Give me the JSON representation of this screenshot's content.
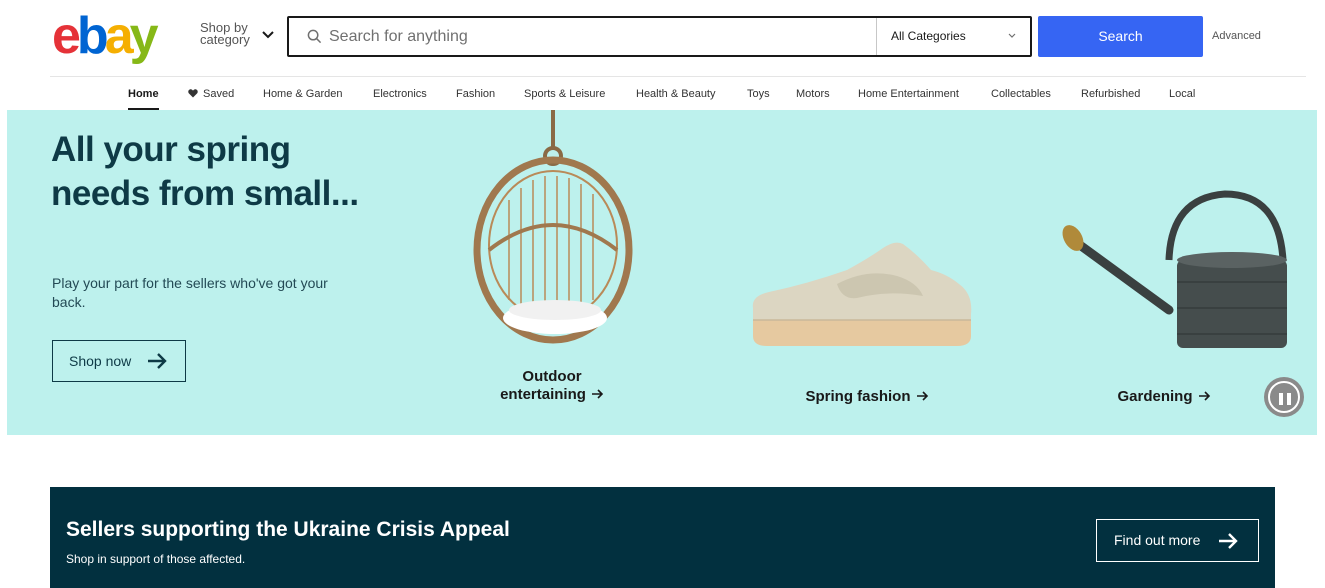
{
  "header": {
    "logo_letters": [
      "e",
      "b",
      "a",
      "y"
    ],
    "shop_by_label": "Shop by category",
    "search_placeholder": "Search for anything",
    "category_selected": "All Categories",
    "search_button": "Search",
    "advanced_link": "Advanced"
  },
  "nav": {
    "items": [
      {
        "label": "Home",
        "active": true
      },
      {
        "label": "Saved"
      },
      {
        "label": "Home & Garden"
      },
      {
        "label": "Electronics"
      },
      {
        "label": "Fashion"
      },
      {
        "label": "Sports & Leisure"
      },
      {
        "label": "Health & Beauty"
      },
      {
        "label": "Toys"
      },
      {
        "label": "Motors"
      },
      {
        "label": "Home Entertainment"
      },
      {
        "label": "Collectables"
      },
      {
        "label": "Refurbished"
      },
      {
        "label": "Local"
      }
    ]
  },
  "hero": {
    "title": "All your spring needs from small...",
    "subtitle": "Play your part for the sellers who've got your back.",
    "cta": "Shop now",
    "products": [
      {
        "label_line1": "Outdoor",
        "label_line2": "entertaining",
        "icon": "hanging-chair"
      },
      {
        "label": "Spring fashion",
        "icon": "sneaker"
      },
      {
        "label": "Gardening",
        "icon": "watering-can"
      }
    ]
  },
  "banner": {
    "title": "Sellers supporting the Ukraine Crisis Appeal",
    "subtitle": "Shop in support of those affected.",
    "cta": "Find out more"
  },
  "colors": {
    "search_blue": "#3665f3",
    "hero_bg": "#bdf1ed",
    "banner_bg": "#02303f",
    "logo_e": "#e53238",
    "logo_b": "#0064d2",
    "logo_a": "#f5af02",
    "logo_y": "#86b817"
  }
}
